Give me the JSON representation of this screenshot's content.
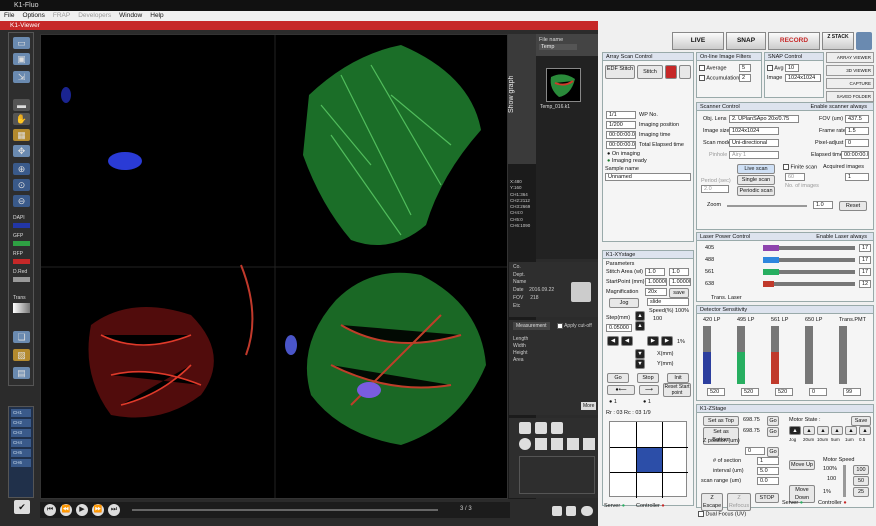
{
  "app": {
    "title": "K1-Fluo"
  },
  "menu": [
    "File",
    "Options",
    "FRAP",
    "Developers",
    "Window",
    "Help"
  ],
  "viewer": {
    "title": "K1-Viewer"
  },
  "channels": {
    "dapi": "DAPI",
    "gfp": "GFP",
    "rfp": "RFP",
    "dred": "D.Red",
    "trans": "Trans"
  },
  "left_tabs": [
    "CH1",
    "CH2",
    "CH3",
    "CH4",
    "CH5",
    "CH6"
  ],
  "image_stats": "X:480\nY:160\nCH1:364\nCH2:2112\nCH3:2669\nCH4:0\nCH5:0\nCH6:1090",
  "side": {
    "show_graph": "Show graph",
    "file_name_label": "File name",
    "file_name": "Temp",
    "thumb_label": "Temp_016.k1"
  },
  "meta": {
    "co": "Co.",
    "dept": "Dept.",
    "name": "Name",
    "date_label": "Date",
    "date": "2016.09.22",
    "fov_label": "FOV",
    "fov": "218",
    "etc": "Etc"
  },
  "measurement": {
    "button": "Measurement",
    "apply": "Apply cut-off",
    "length": "Length",
    "width": "Width",
    "height": "Height",
    "area": "Area",
    "more": "More"
  },
  "playback": {
    "counter": "3 / 3"
  },
  "top": {
    "live": "LIVE",
    "snap": "SNAP",
    "record": "RECORD",
    "zstack": "Z STACK"
  },
  "right_buttons": [
    "ARRAY VIEWER",
    "3D VIEWER",
    "CAPTURE",
    "SAVED FOLDER"
  ],
  "array_scan": {
    "title": "Array Scan Control",
    "edf_stitch": "EDF Stitch",
    "stitch": "Stitch",
    "wp_no_value": "1/1",
    "wp_no": "WP No.",
    "imaging_position_value": "1/200",
    "imaging_position": "Imaging position",
    "imaging_time_value": "00:00:00.0",
    "imaging_time": "Imaging time",
    "total_elapsed_value": "00:00:00.0",
    "total_elapsed": "Total Elapsed time",
    "on_imaging": "On imaging",
    "imaging_ready": "Imaging ready",
    "sample_name": "Sample name",
    "sample_value": "Unnamed"
  },
  "filters": {
    "title": "On-line Image Filters",
    "average": "Average",
    "average_value": "5",
    "accumulation": "Accumulation",
    "accumulation_value": "2"
  },
  "snap_ctrl": {
    "title": "SNAP Control",
    "avg": "Avg",
    "avg_value": "10",
    "image": "Image",
    "image_value": "1024x1024"
  },
  "scanner": {
    "title": "Scanner Control",
    "enable": "Enable scanner always",
    "obj_lens": "Obj. Lens",
    "obj_value": "2. UPlanSApo 20x/0.75",
    "fov": "FOV (um)",
    "fov_value": "437.5",
    "image_size": "Image size",
    "image_size_value": "1024x1024",
    "frame_rate": "Frame rate",
    "frame_rate_value": "1.5",
    "scan_mode": "Scan mode",
    "scan_mode_value": "Uni-directional",
    "pixel_adjust": "Pixel-adjust",
    "pixel_adjust_value": "0",
    "pinhole": "Pinhole",
    "pinhole_value": "Airy 1",
    "elapsed": "Elapsed time",
    "elapsed_value": "00:00:00.0",
    "live_scan": "Live scan",
    "single_scan": "Single scan",
    "periodic_scan": "Periodic scan",
    "finite_scan": "Finite scan",
    "finite_value": "60",
    "no_images": "No. of images",
    "acquired": "Acquired images",
    "acquired_value": "1",
    "period": "Period (sec)",
    "period_value": "2.0",
    "zoom": "Zoom",
    "zoom_value": "1.0",
    "reset": "Reset"
  },
  "laser": {
    "title": "Laser Power Control",
    "enable": "Enable Laser always",
    "lines": [
      {
        "name": "405",
        "value": "17",
        "color": "#8e44ad",
        "level": 0.17
      },
      {
        "name": "488",
        "value": "17",
        "color": "#2e86de",
        "level": 0.17
      },
      {
        "name": "561",
        "value": "17",
        "color": "#27ae60",
        "level": 0.17
      },
      {
        "name": "638",
        "value": "12",
        "color": "#c0392b",
        "level": 0.12
      }
    ],
    "trans": "Trans. Laser"
  },
  "detector": {
    "title": "Detector Sensitivity",
    "channels": [
      {
        "name": "420 LP",
        "value": "520",
        "color": "#2c3e9e",
        "level": 0.55
      },
      {
        "name": "495 LP",
        "value": "520",
        "color": "#27ae60",
        "level": 0.55
      },
      {
        "name": "561 LP",
        "value": "520",
        "color": "#c0392b",
        "level": 0.55
      },
      {
        "name": "650 LP",
        "value": "0",
        "color": "#888888",
        "level": 0.0
      },
      {
        "name": "Trans.PMT",
        "value": "99",
        "color": "#dddddd",
        "level": 0.0
      }
    ]
  },
  "xystage": {
    "title": "K1-XYstage",
    "parameters": "Parameters",
    "stitch_area": "Stitch Area (wl)",
    "stitch_a": "1.0",
    "stitch_b": "1.0",
    "start_point": "StartPoint (mm)",
    "start_a": "1.00000",
    "start_b": "1.00000",
    "magnification": "Magnification",
    "mag_value": "20x",
    "save": "save",
    "jog": "Jog",
    "slide": "slide",
    "step": "Step(mm)",
    "step_value": "0.05000",
    "speed": "Speed(%)",
    "speed_value": "100",
    "speed_a": "100%",
    "speed_b": "1%",
    "x_mm": "X(mm)",
    "y_mm": "Y(mm)",
    "go": "Go",
    "stop": "Stop",
    "init": "Init",
    "reset_start": "Reset Start point",
    "radio_a": "1",
    "radio_b": "1",
    "ratio": "Rr : 03  Rc : 03  1/9"
  },
  "zstage": {
    "title": "K1-ZStage",
    "motor_state": "Motor State :",
    "save": "Save",
    "set_top": "Set as Top",
    "top_value": "698.75",
    "set_bottom": "Set as Bottom",
    "bottom_value": "698.75",
    "go": "Go",
    "z_position": "Z position (um)",
    "z_value": "0",
    "sections": "# of section",
    "sections_value": "1",
    "interval": "interval (um)",
    "interval_value": "5.0",
    "scan_range": "scan range (um)",
    "range_value": "0.0",
    "steps": [
      "Jog",
      "20um",
      "10um",
      "5um",
      "1um",
      "0.5"
    ],
    "move_up": "Move Up",
    "move_down": "Move Down",
    "motor_speed": "Motor Speed",
    "speed_100": "100%",
    "speed_1": "1%",
    "speed_value": "100",
    "z_escape": "Z Escape",
    "z_refocus": "Z Refocus",
    "stop": "STOP",
    "btn_100": "100",
    "btn_50": "50",
    "btn_25": "25"
  },
  "status": {
    "server": "Server",
    "controller": "Controller"
  },
  "dual_focus": "Dual Focus (UV)"
}
